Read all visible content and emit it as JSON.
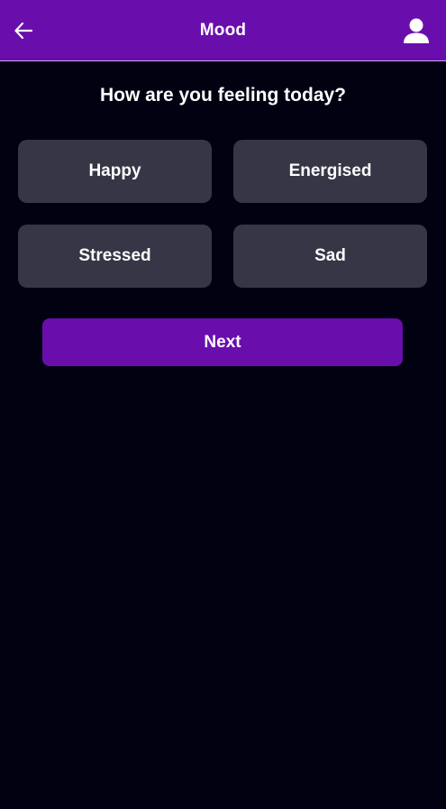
{
  "header": {
    "title": "Mood",
    "back_icon": "arrow-left-icon",
    "profile_icon": "user-icon",
    "background_color": "#6a0dad"
  },
  "main": {
    "question": "How are you feeling today?",
    "moods": [
      {
        "label": "Happy"
      },
      {
        "label": "Energised"
      },
      {
        "label": "Stressed"
      },
      {
        "label": "Sad"
      }
    ],
    "next_label": "Next"
  },
  "colors": {
    "background": "#010111",
    "accent": "#6a0dad",
    "card": "#363646",
    "text": "#ffffff"
  }
}
